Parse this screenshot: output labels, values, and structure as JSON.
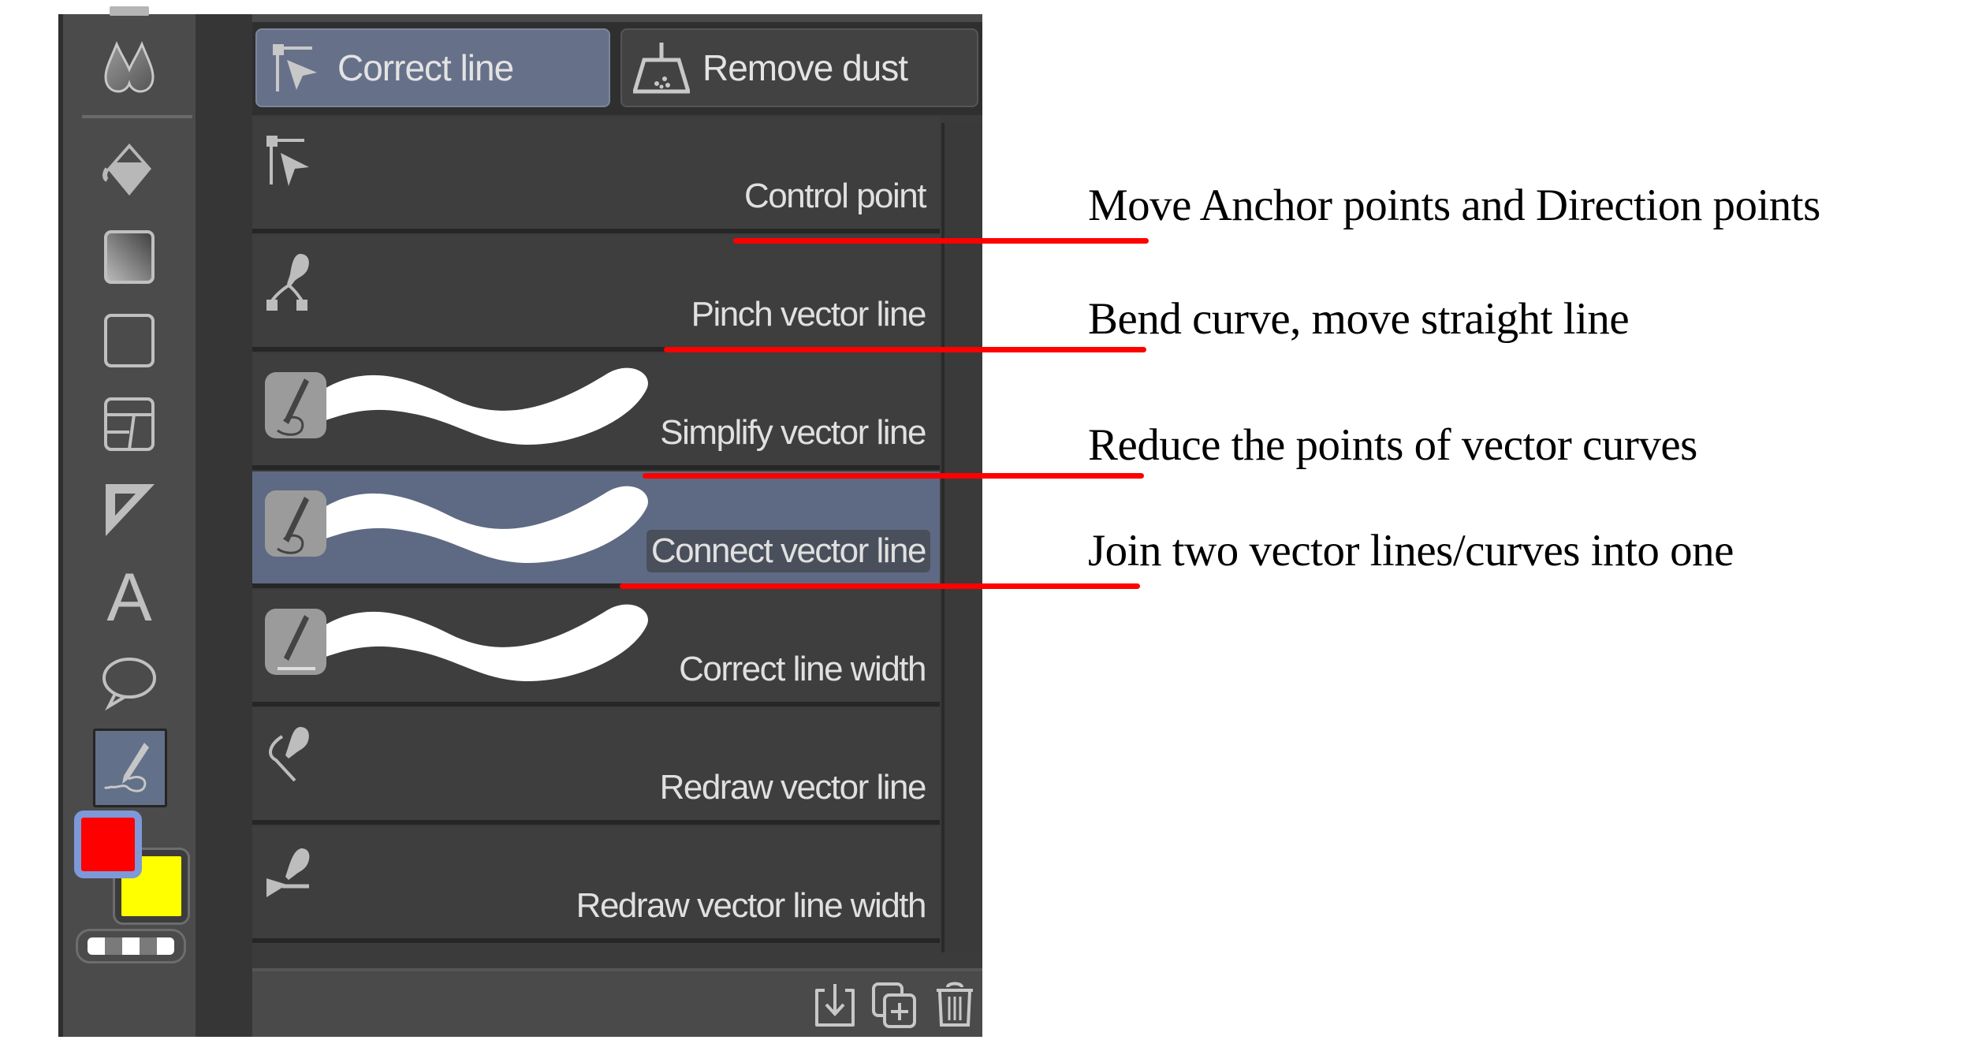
{
  "toolbar": {
    "tools": [
      {
        "name": "blend-tool",
        "icon": "droplets-icon"
      },
      {
        "name": "fill-tool",
        "icon": "paint-bucket-icon"
      },
      {
        "name": "gradient-tool",
        "icon": "gradient-icon"
      },
      {
        "name": "figure-tool",
        "icon": "rectangle-icon"
      },
      {
        "name": "frame-border-tool",
        "icon": "frame-border-icon"
      },
      {
        "name": "ruler-tool",
        "icon": "ruler-triangle-icon"
      },
      {
        "name": "text-tool",
        "icon": "text-icon",
        "glyph": "A"
      },
      {
        "name": "balloon-tool",
        "icon": "speech-balloon-icon"
      },
      {
        "name": "correct-line-tool",
        "icon": "correct-line-icon",
        "active": true
      }
    ],
    "colors": {
      "main_color": "#ff0000",
      "sub_color": "#ffff00",
      "selection_outline": "#7d99d8"
    }
  },
  "subtool_tabs": [
    {
      "label": "Correct line",
      "icon": "control-point-icon",
      "selected": true
    },
    {
      "label": "Remove dust",
      "icon": "dustpan-icon",
      "selected": false
    }
  ],
  "subtools": [
    {
      "label": "Control point",
      "icon": "control-point-icon",
      "preview": false,
      "selected": false
    },
    {
      "label": "Pinch vector line",
      "icon": "pinch-vector-icon",
      "preview": false,
      "selected": false
    },
    {
      "label": "Simplify vector line",
      "icon": "vector-brush-icon",
      "preview": true,
      "selected": false
    },
    {
      "label": "Connect vector line",
      "icon": "vector-brush-icon",
      "preview": true,
      "selected": true
    },
    {
      "label": "Correct line width",
      "icon": "line-width-brush-icon",
      "preview": true,
      "selected": false
    },
    {
      "label": "Redraw vector line",
      "icon": "redraw-vector-icon",
      "preview": false,
      "selected": false
    },
    {
      "label": "Redraw vector line width",
      "icon": "redraw-width-icon",
      "preview": false,
      "selected": false
    }
  ],
  "footer_buttons": [
    {
      "name": "import-subtool",
      "icon": "download-icon"
    },
    {
      "name": "duplicate-subtool",
      "icon": "duplicate-add-icon"
    },
    {
      "name": "delete-subtool",
      "icon": "trash-icon"
    }
  ],
  "annotations": [
    {
      "text": "Move Anchor points and Direction points",
      "target": "Control point",
      "color": "#ff0000"
    },
    {
      "text": "Bend curve, move straight line",
      "target": "Pinch vector line",
      "color": "#ff0000"
    },
    {
      "text": "Reduce the points of vector curves",
      "target": "Simplify vector line",
      "color": "#ff0000"
    },
    {
      "text": "Join two vector lines/curves into one",
      "target": "Connect vector line",
      "color": "#ff0000"
    }
  ],
  "theme": {
    "selected_bg": "#5e6a83",
    "panel_bg": "#3e3e3e",
    "text": "#e0e0e0"
  }
}
